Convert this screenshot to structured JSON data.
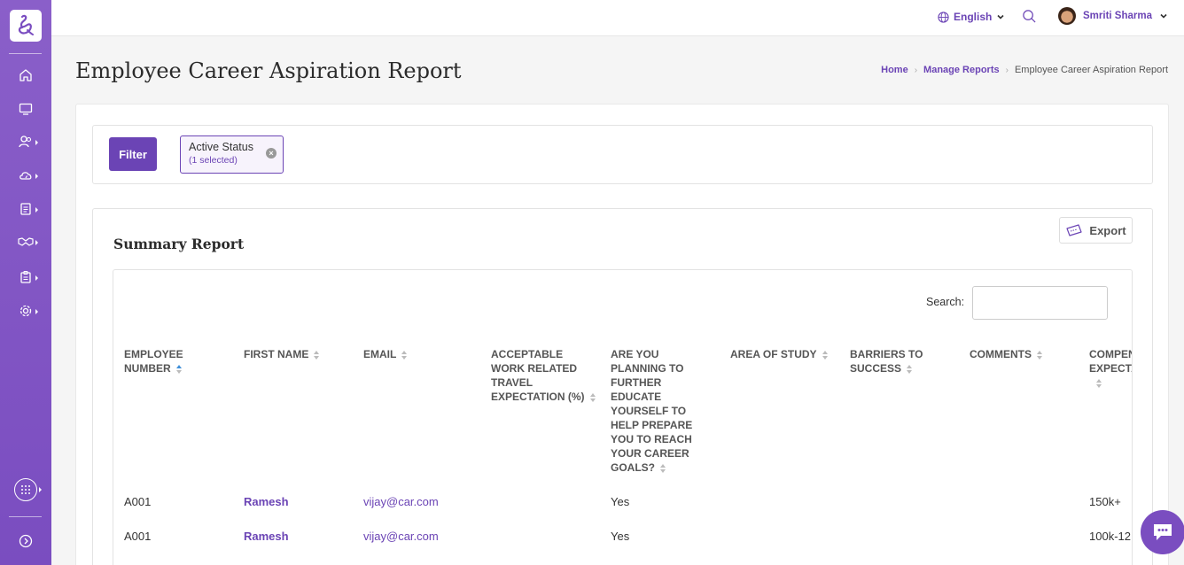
{
  "topbar": {
    "language": "English",
    "user_name": "Smriti Sharma"
  },
  "page": {
    "title": "Employee Career Aspiration Report",
    "breadcrumb": [
      "Home",
      "Manage Reports",
      "Employee Career Aspiration Report"
    ]
  },
  "filter": {
    "button_label": "Filter",
    "chip_title": "Active Status",
    "chip_subtitle": "(1 selected)"
  },
  "report": {
    "title": "Summary Report",
    "export_label": "Export",
    "search_label": "Search:",
    "search_value": "",
    "columns": [
      "Employee Number",
      "First Name",
      "Email",
      "Acceptable Work Related Travel Expectation (%)",
      "Are You Planning To Further Educate Yourself To Help Prepare You To Reach Your Career Goals?",
      "Area Of Study",
      "Barriers To Success",
      "Comments",
      "Compen Expecta"
    ],
    "rows": [
      {
        "employee_number": "A001",
        "first_name": "Ramesh",
        "email": "vijay@car.com",
        "travel": "",
        "education": "Yes",
        "area": "",
        "barriers": "",
        "comments": "",
        "compensation": "150k+"
      },
      {
        "employee_number": "A001",
        "first_name": "Ramesh",
        "email": "vijay@car.com",
        "travel": "",
        "education": "Yes",
        "area": "",
        "barriers": "",
        "comments": "",
        "compensation": "100k-12"
      }
    ]
  },
  "colors": {
    "accent": "#6b44b5",
    "sidebar": "#7a4dc0"
  }
}
